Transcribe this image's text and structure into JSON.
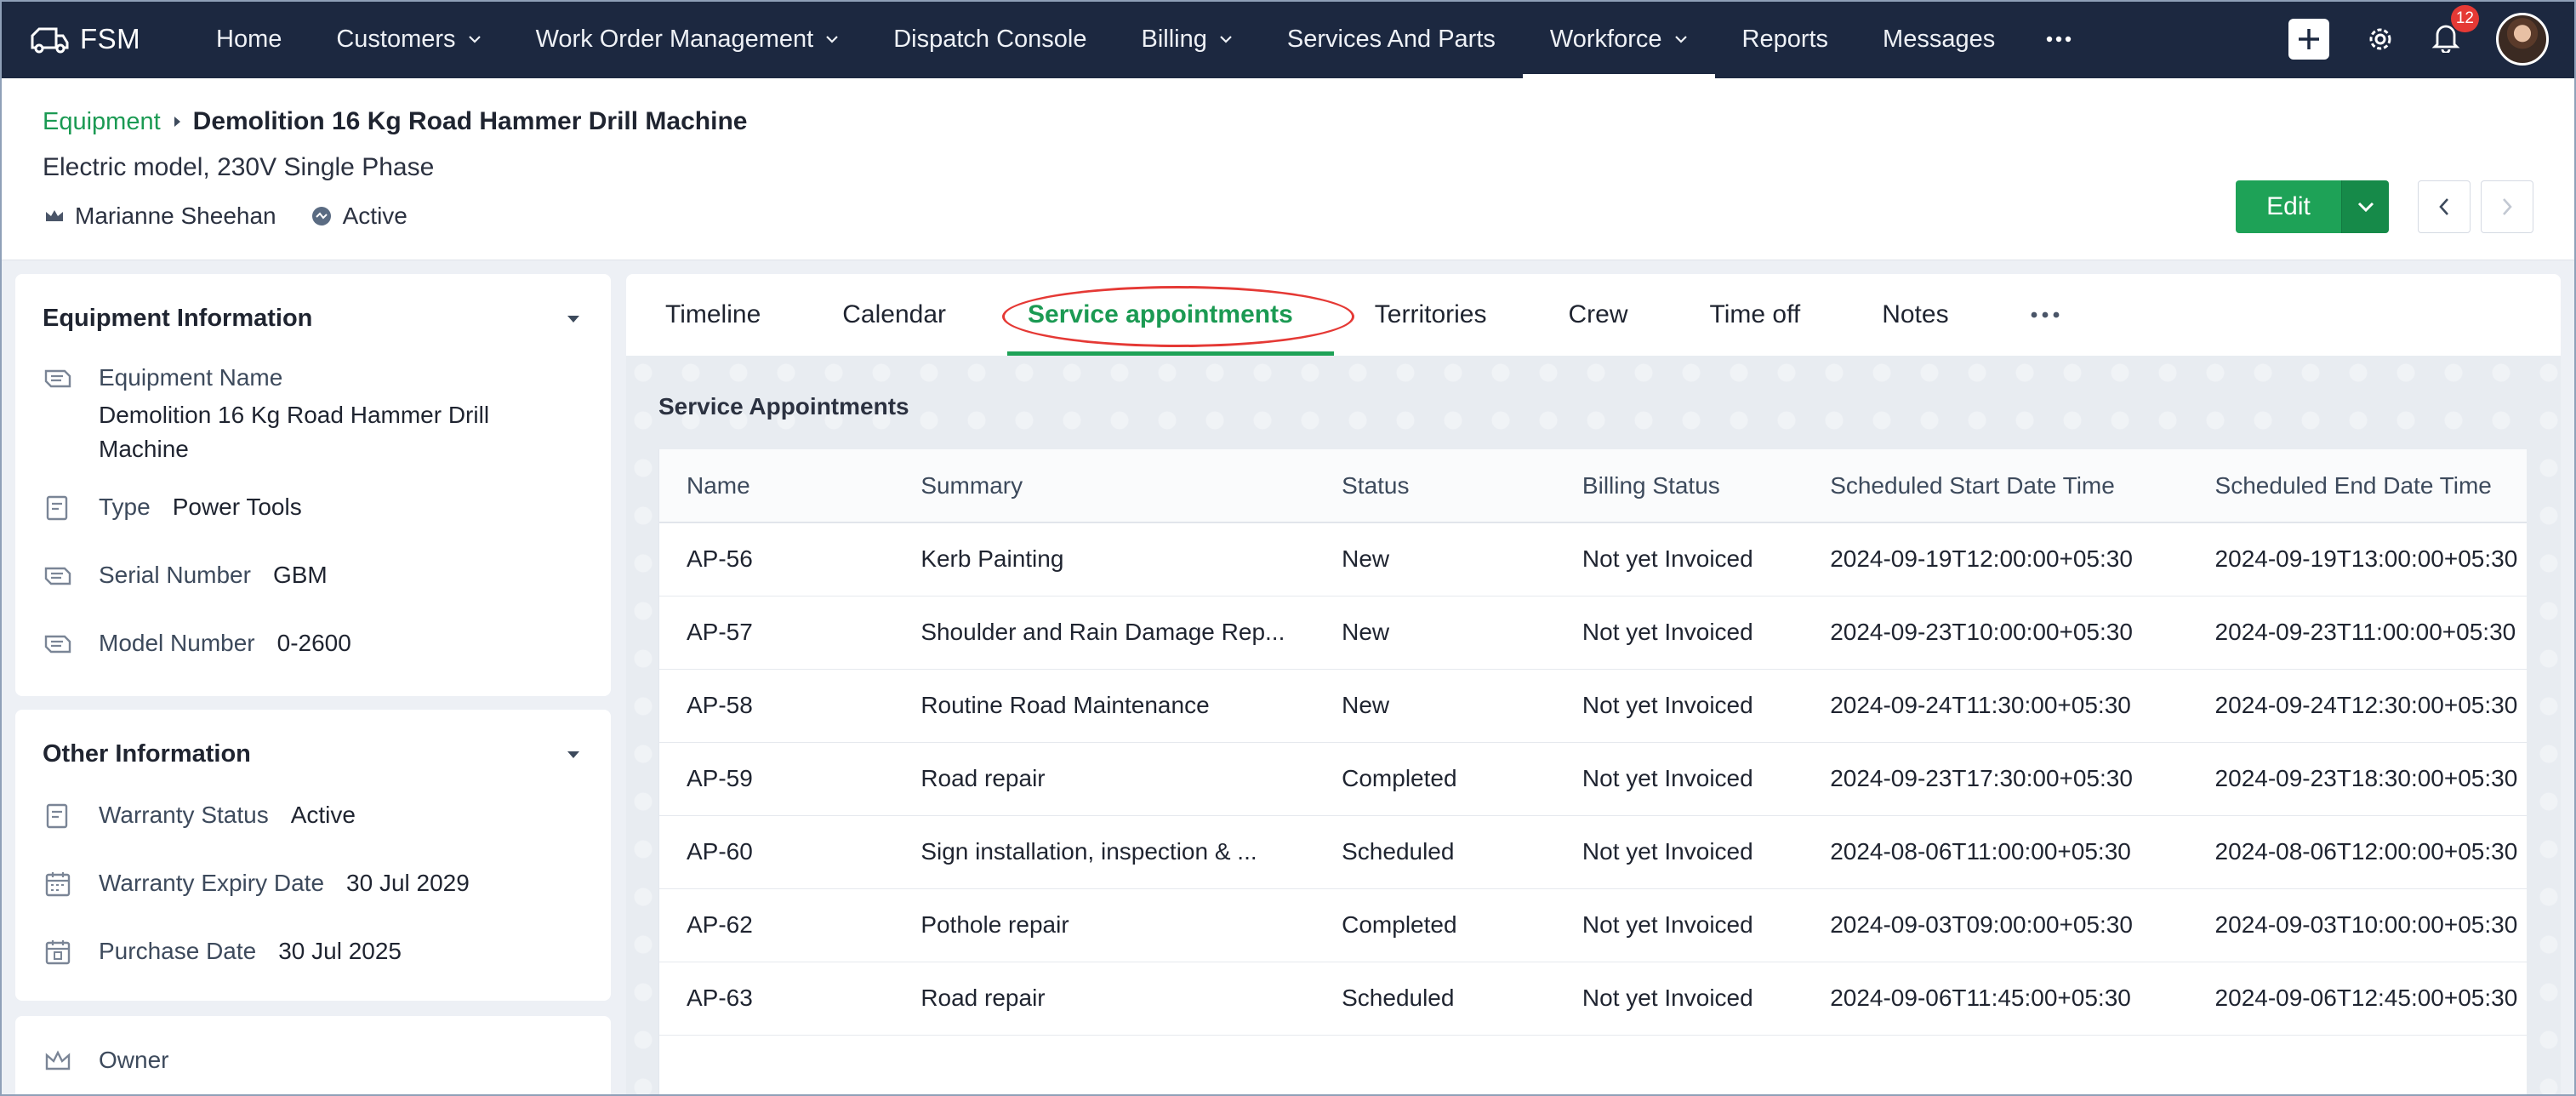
{
  "nav": {
    "brand": "FSM",
    "items": [
      {
        "label": "Home",
        "dropdown": false,
        "active": false
      },
      {
        "label": "Customers",
        "dropdown": true,
        "active": false
      },
      {
        "label": "Work Order Management",
        "dropdown": true,
        "active": false
      },
      {
        "label": "Dispatch Console",
        "dropdown": false,
        "active": false
      },
      {
        "label": "Billing",
        "dropdown": true,
        "active": false
      },
      {
        "label": "Services And Parts",
        "dropdown": false,
        "active": false
      },
      {
        "label": "Workforce",
        "dropdown": true,
        "active": true
      },
      {
        "label": "Reports",
        "dropdown": false,
        "active": false
      },
      {
        "label": "Messages",
        "dropdown": false,
        "active": false
      }
    ],
    "more_icon": "more-horizontal-icon",
    "notification_count": "12"
  },
  "header": {
    "breadcrumb_link": "Equipment",
    "title": "Demolition 16 Kg Road Hammer Drill Machine",
    "subtitle": "Electric model, 230V Single Phase",
    "owner": "Marianne Sheehan",
    "status": "Active",
    "edit_label": "Edit"
  },
  "equipment_info": {
    "title": "Equipment Information",
    "fields": [
      {
        "label": "Equipment Name",
        "value": "Demolition 16 Kg Road Hammer Drill Machine"
      },
      {
        "label": "Type",
        "value": "Power Tools"
      },
      {
        "label": "Serial Number",
        "value": "GBM"
      },
      {
        "label": "Model Number",
        "value": "0-2600"
      }
    ]
  },
  "other_info": {
    "title": "Other Information",
    "fields": [
      {
        "label": "Warranty Status",
        "value": "Active"
      },
      {
        "label": "Warranty Expiry Date",
        "value": "30 Jul 2029"
      },
      {
        "label": "Purchase Date",
        "value": "30 Jul 2025"
      }
    ]
  },
  "owner_card": {
    "title": "Owner"
  },
  "tabs": [
    "Timeline",
    "Calendar",
    "Service appointments",
    "Territories",
    "Crew",
    "Time off",
    "Notes"
  ],
  "active_tab": "Service appointments",
  "appointments": {
    "title": "Service Appointments",
    "columns": [
      "Name",
      "Summary",
      "Status",
      "Billing Status",
      "Scheduled Start Date Time",
      "Scheduled End Date Time"
    ],
    "rows": [
      [
        "AP-56",
        "Kerb Painting",
        "New",
        "Not yet Invoiced",
        "2024-09-19T12:00:00+05:30",
        "2024-09-19T13:00:00+05:30"
      ],
      [
        "AP-57",
        "Shoulder and Rain Damage Rep...",
        "New",
        "Not yet Invoiced",
        "2024-09-23T10:00:00+05:30",
        "2024-09-23T11:00:00+05:30"
      ],
      [
        "AP-58",
        "Routine Road Maintenance",
        "New",
        "Not yet Invoiced",
        "2024-09-24T11:30:00+05:30",
        "2024-09-24T12:30:00+05:30"
      ],
      [
        "AP-59",
        "Road repair",
        "Completed",
        "Not yet Invoiced",
        "2024-09-23T17:30:00+05:30",
        "2024-09-23T18:30:00+05:30"
      ],
      [
        "AP-60",
        "Sign installation, inspection & ...",
        "Scheduled",
        "Not yet Invoiced",
        "2024-08-06T11:00:00+05:30",
        "2024-08-06T12:00:00+05:30"
      ],
      [
        "AP-62",
        "Pothole repair",
        "Completed",
        "Not yet Invoiced",
        "2024-09-03T09:00:00+05:30",
        "2024-09-03T10:00:00+05:30"
      ],
      [
        "AP-63",
        "Road repair",
        "Scheduled",
        "Not yet Invoiced",
        "2024-09-06T11:45:00+05:30",
        "2024-09-06T12:45:00+05:30"
      ]
    ]
  },
  "colors": {
    "nav_bg": "#1c2840",
    "accent_green": "#1ea257",
    "highlight_red": "#e53935"
  }
}
